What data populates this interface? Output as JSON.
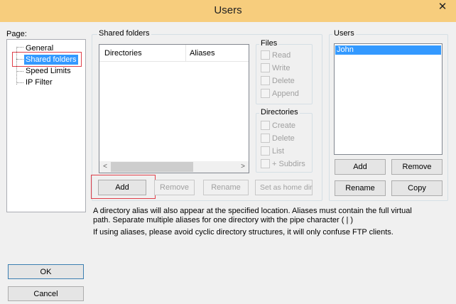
{
  "window": {
    "title": "Users",
    "close_glyph": "✕"
  },
  "page_tree": {
    "label": "Page:",
    "items": [
      {
        "label": "General",
        "selected": false
      },
      {
        "label": "Shared folders",
        "selected": true
      },
      {
        "label": "Speed Limits",
        "selected": false
      },
      {
        "label": "IP Filter",
        "selected": false
      }
    ]
  },
  "shared_folders": {
    "legend": "Shared folders",
    "columns": [
      "Directories",
      "Aliases"
    ],
    "scroll_left": "<",
    "scroll_right": ">",
    "buttons": {
      "add": "Add",
      "remove": "Remove",
      "rename": "Rename",
      "set_home": "Set as home dir"
    }
  },
  "files": {
    "legend": "Files",
    "options": [
      "Read",
      "Write",
      "Delete",
      "Append"
    ]
  },
  "directories": {
    "legend": "Directories",
    "options": [
      "Create",
      "Delete",
      "List",
      "+ Subdirs"
    ]
  },
  "users": {
    "legend": "Users",
    "list": [
      "John"
    ],
    "buttons": {
      "add": "Add",
      "remove": "Remove",
      "rename": "Rename",
      "copy": "Copy"
    }
  },
  "info": {
    "line1": "A directory alias will also appear at the specified location. Aliases must contain the full virtual",
    "line2": "path. Separate multiple aliases for one directory with the pipe character ( | )",
    "line3": "If using aliases, please avoid cyclic directory structures, it will only confuse FTP clients."
  },
  "dialog_buttons": {
    "ok": "OK",
    "cancel": "Cancel"
  },
  "colors": {
    "title_bar": "#f7cd7d",
    "selection": "#3399ff",
    "highlight_box": "#e0404a"
  }
}
